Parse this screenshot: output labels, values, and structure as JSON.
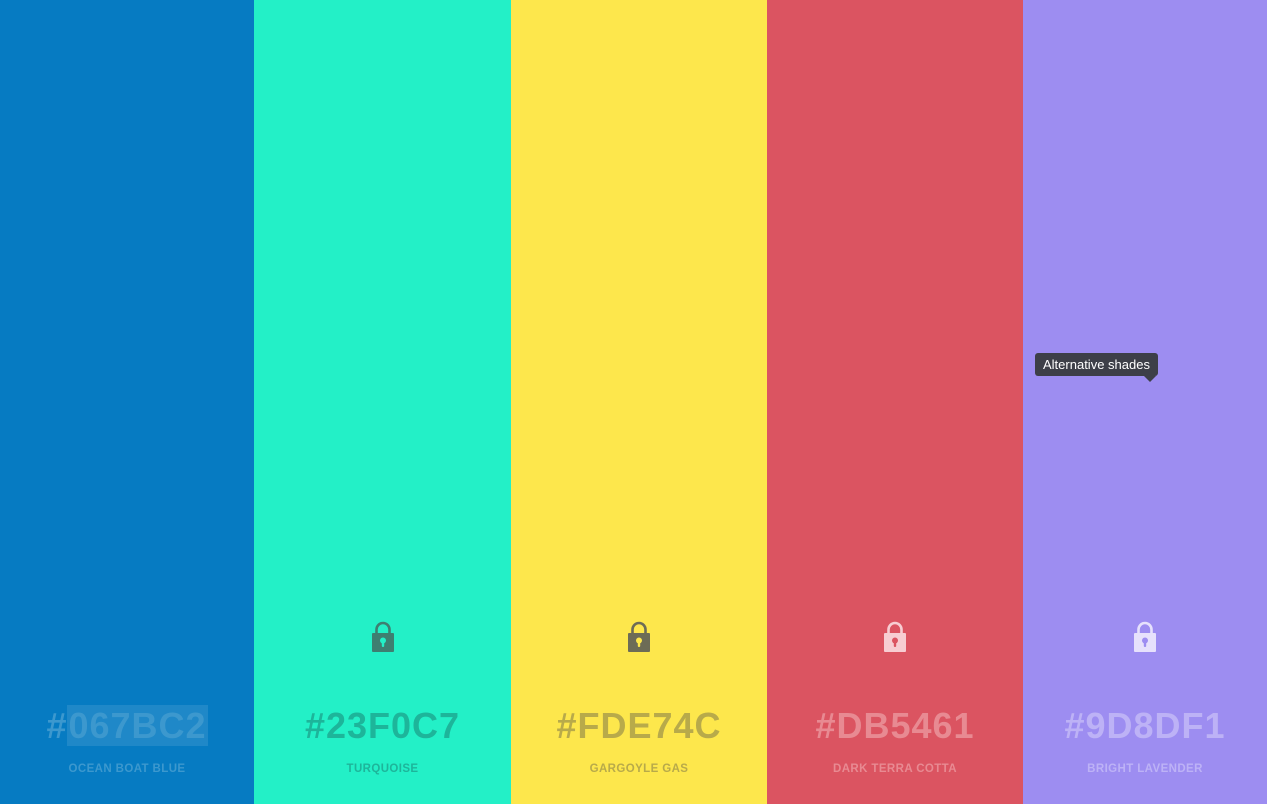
{
  "palette": {
    "colors": [
      {
        "hex_prefix": "#",
        "hex_code": "067BC2",
        "name": "OCEAN BOAT BLUE",
        "background": "#067BC2",
        "text_color": "#3C98CE",
        "locked": false,
        "show_lock": false,
        "selected": true
      },
      {
        "hex_prefix": "#",
        "hex_code": "23F0C7",
        "name": "TURQUOISE",
        "background": "#23F0C7",
        "text_color": "#1DB59A",
        "icon_color": "#3E7F71",
        "locked": true,
        "show_lock": true,
        "selected": false
      },
      {
        "hex_prefix": "#",
        "hex_code": "FDE74C",
        "name": "GARGOYLE GAS",
        "background": "#FDE74C",
        "text_color": "#B8AA4A",
        "icon_color": "#6D6C56",
        "locked": true,
        "show_lock": true,
        "selected": false
      },
      {
        "hex_prefix": "#",
        "hex_code": "DB5461",
        "name": "DARK TERRA COTTA",
        "background": "#DB5461",
        "text_color": "#E88A92",
        "icon_color": "#F7CDD2",
        "locked": true,
        "show_lock": true,
        "selected": false
      },
      {
        "hex_prefix": "#",
        "hex_code": "9D8DF1",
        "name": "BRIGHT LAVENDER",
        "background": "#9D8DF1",
        "text_color": "#BDB2F6",
        "icon_color": "#E6E1FC",
        "locked": true,
        "show_lock": true,
        "selected": false
      }
    ]
  },
  "tooltip": {
    "text": "Alternative shades"
  }
}
